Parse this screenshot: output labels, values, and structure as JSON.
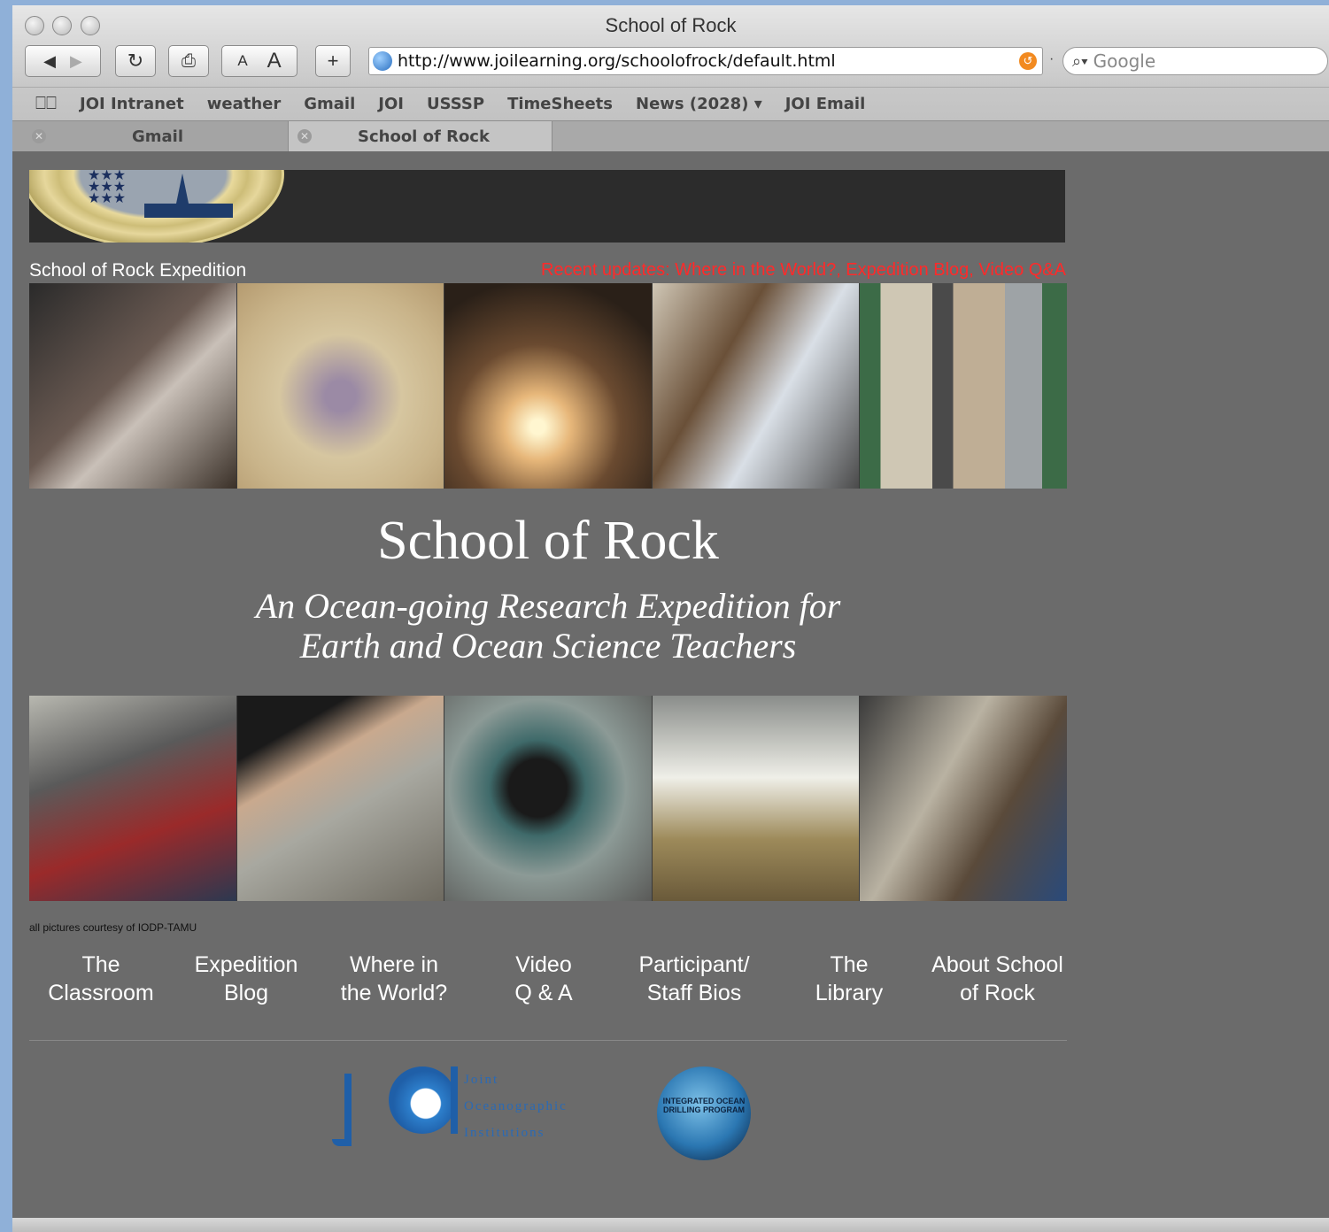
{
  "window": {
    "title": "School of Rock"
  },
  "toolbar": {
    "back_icon": "back-arrow-icon",
    "forward_icon": "forward-arrow-icon",
    "reload_icon": "reload-icon",
    "print_icon": "printer-icon",
    "text_smaller_label": "A",
    "text_larger_label": "A",
    "add_bookmark_label": "+",
    "url": "http://www.joilearning.org/schoolofrock/default.html",
    "search_placeholder": "Google"
  },
  "bookmarks": {
    "icon": "open-book-icon",
    "items": [
      "JOI Intranet",
      "weather",
      "Gmail",
      "JOI",
      "USSSP",
      "TimeSheets",
      "News (2028) ▾",
      "JOI Email"
    ]
  },
  "tabs": [
    {
      "label": "Gmail",
      "active": false
    },
    {
      "label": "School of Rock",
      "active": true
    }
  ],
  "page": {
    "expedition_label": "School of Rock Expedition",
    "recent_updates": "Recent updates: Where in the World?, Expedition Blog, Video Q&A",
    "title": "School of Rock",
    "subtitle_line1": "An Ocean-going Research Expedition for",
    "subtitle_line2": "Earth and Ocean Science Teachers",
    "photo_credit": "all pictures courtesy of IODP-TAMU",
    "nav": [
      {
        "line1": "The",
        "line2": "Classroom"
      },
      {
        "line1": "Expedition",
        "line2": "Blog"
      },
      {
        "line1": "Where in",
        "line2": "the World?"
      },
      {
        "line1": "Video",
        "line2": "Q & A"
      },
      {
        "line1": "Participant/",
        "line2": "Staff Bios"
      },
      {
        "line1": "The",
        "line2": "Library"
      },
      {
        "line1": "About School",
        "line2": "of Rock"
      }
    ],
    "joi_text": [
      "Joint",
      "Oceanographic",
      "Institutions"
    ],
    "iodp_text": "INTEGRATED OCEAN DRILLING PROGRAM"
  },
  "colors": {
    "page_background": "#6b6b6b",
    "recent_updates": "#ff2a2a",
    "banner": "#2c2c2c"
  }
}
